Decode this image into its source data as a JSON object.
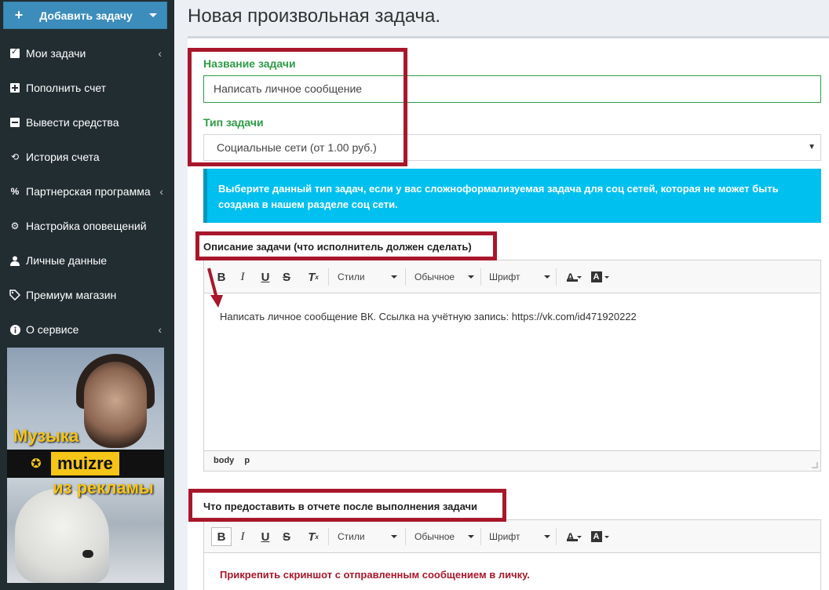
{
  "sidebar": {
    "add_task_label": "Добавить задачу",
    "items": [
      {
        "label": "Мои задачи",
        "icon": "checkbox-icon"
      },
      {
        "label": "Пополнить счет",
        "icon": "plus-square-icon"
      },
      {
        "label": "Вывести средства",
        "icon": "minus-square-icon"
      },
      {
        "label": "История счета",
        "icon": "history-icon"
      },
      {
        "label": "Партнерская программа",
        "icon": "percent-icon"
      },
      {
        "label": "Настройка оповещений",
        "icon": "gears-icon"
      },
      {
        "label": "Личные данные",
        "icon": "user-icon"
      },
      {
        "label": "Премиум магазин",
        "icon": "tag-icon"
      },
      {
        "label": "О сервисе",
        "icon": "info-icon"
      }
    ],
    "ad": {
      "line1": "Музыка",
      "brand": "muizre",
      "line2": "из рекламы"
    }
  },
  "page": {
    "title": "Новая произвольная задача."
  },
  "form": {
    "task_name_label": "Название задачи",
    "task_name_value": "Написать личное сообщение",
    "task_type_label": "Тип задачи",
    "task_type_value": "Социальные сети (от 1.00 руб.)",
    "info_text": "Выберите данный тип задач, если у вас сложноформализуемая задача для соц сетей, которая не может быть создана в нашем разделе соц сети.",
    "description_label": "Описание задачи (что исполнитель должен сделать)",
    "description_text": "Написать личное сообщение ВК. Ссылка на учётную запись: https://vk.com/id471920222",
    "report_label": "Что предоставить в отчете после выполнения задачи",
    "report_text": "Прикрепить скриншот с отправленным сообщением в личку."
  },
  "editor": {
    "styles_label": "Стили",
    "format_label": "Обычное",
    "font_label": "Шрифт",
    "path_body": "body",
    "path_p": "p"
  },
  "colors": {
    "sidebar_bg": "#222d32",
    "primary": "#3c8dbc",
    "success": "#2e9c47",
    "info": "#00c0ef",
    "annotation_red": "#a8172b"
  }
}
